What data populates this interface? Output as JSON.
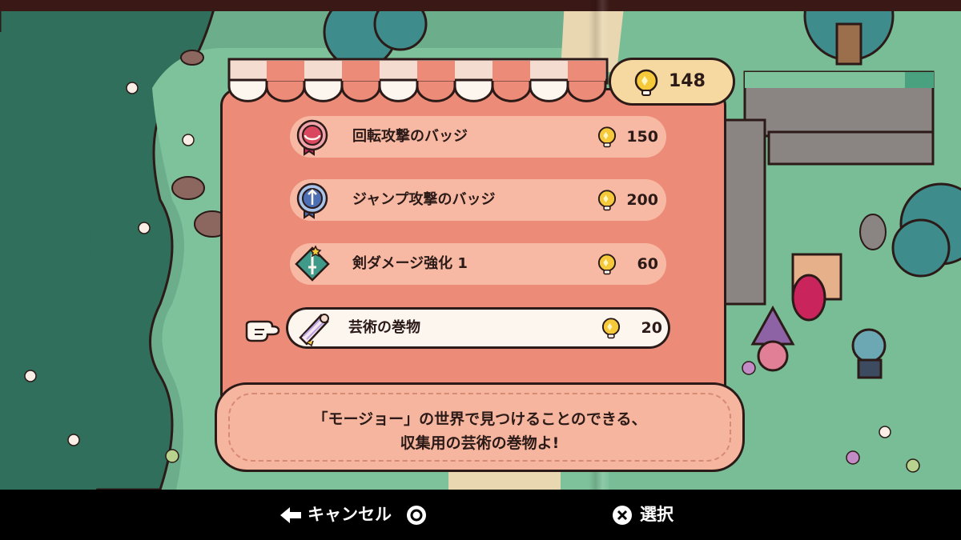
{
  "currency": {
    "value": "148",
    "icon": "lightbulb-coin-icon"
  },
  "shop_items": [
    {
      "name": "回転攻撃のバッジ",
      "price": "150",
      "icon": "spin-attack-badge-icon",
      "selected": false
    },
    {
      "name": "ジャンプ攻撃のバッジ",
      "price": "200",
      "icon": "jump-attack-badge-icon",
      "selected": false
    },
    {
      "name": "剣ダメージ強化 1",
      "price": "60",
      "icon": "sword-upgrade-icon",
      "selected": false
    },
    {
      "name": "芸術の巻物",
      "price": "20",
      "icon": "art-scroll-icon",
      "selected": true
    }
  ],
  "description": {
    "line1": "「モージョー」の世界で見つけることのできる、",
    "line2": "収集用の芸術の巻物よ!"
  },
  "footer": {
    "cancel_label": "キャンセル",
    "select_label": "選択"
  },
  "colors": {
    "panel": "#ec8b78",
    "row": "#f7b9a3",
    "selected_row": "#fdf6ef",
    "coin": "#f5c93a",
    "grass": "#6cae8c"
  }
}
